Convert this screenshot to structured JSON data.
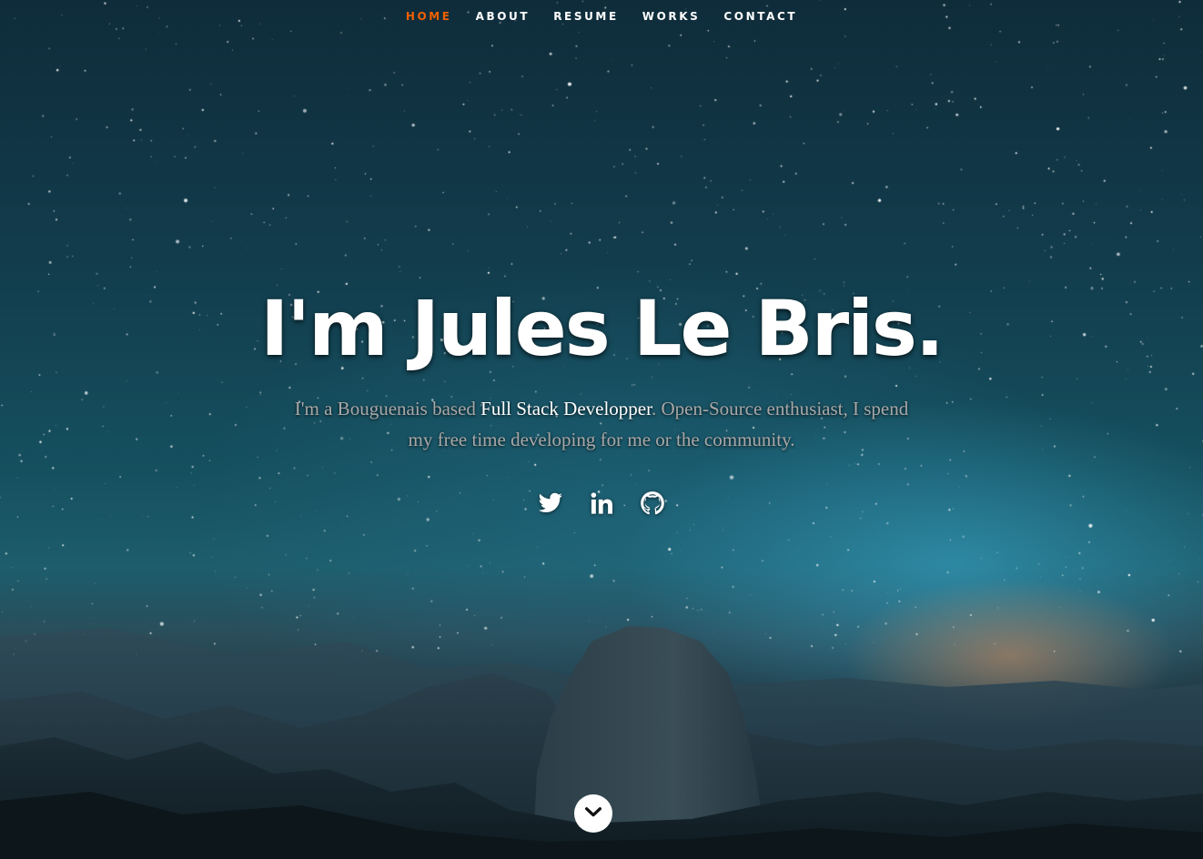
{
  "nav": {
    "items": [
      {
        "label": "HOME",
        "current": true
      },
      {
        "label": "ABOUT",
        "current": false
      },
      {
        "label": "RESUME",
        "current": false
      },
      {
        "label": "WORKS",
        "current": false
      },
      {
        "label": "CONTACT",
        "current": false
      }
    ],
    "current_color": "#F06000"
  },
  "banner": {
    "headline": "I'm Jules Le Bris.",
    "tagline_prefix": "I'm a Bouguenais based ",
    "tagline_highlight": "Full Stack Developper",
    "tagline_suffix": ". Open-Source enthusiast, I spend my free time developing for me or the community."
  },
  "social": [
    {
      "icon": "twitter-icon"
    },
    {
      "icon": "linkedin-icon"
    },
    {
      "icon": "github-icon"
    }
  ],
  "scrolldown": {
    "icon": "chevron-down-icon"
  }
}
